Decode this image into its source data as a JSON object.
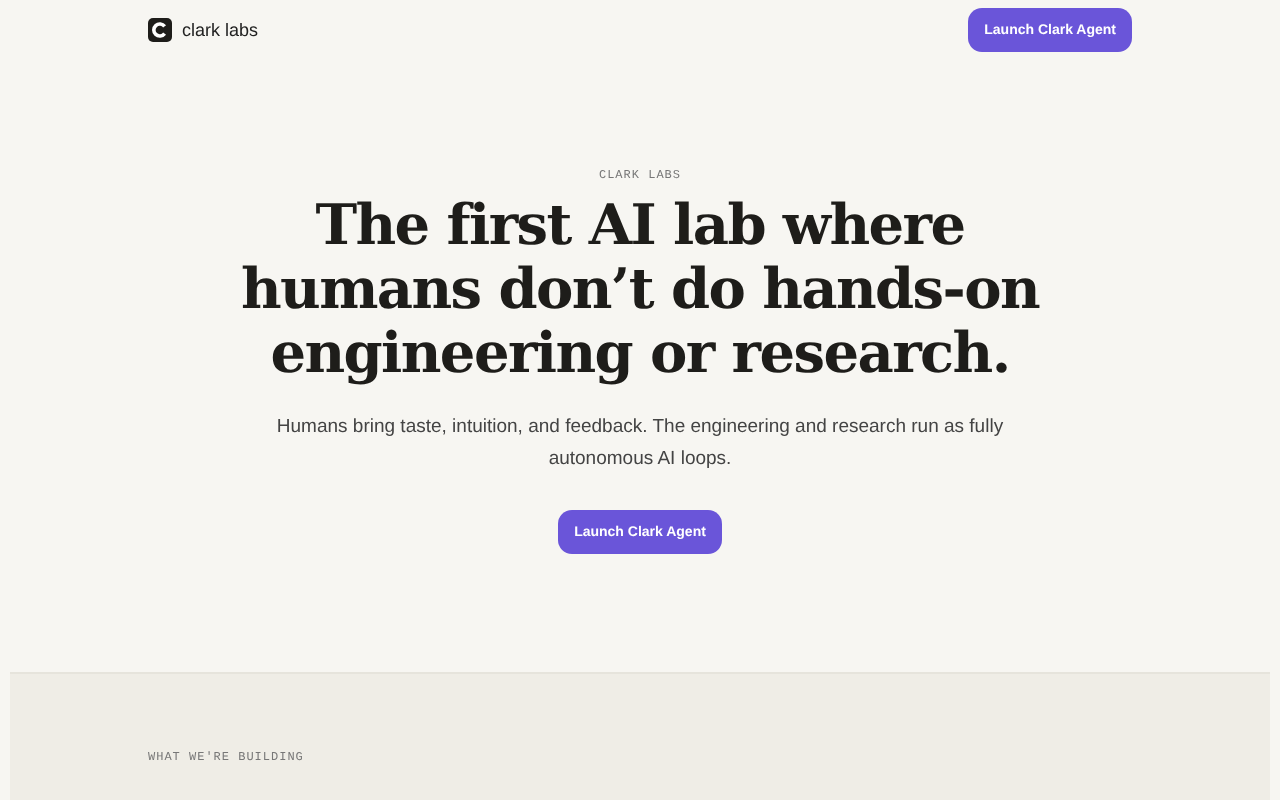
{
  "header": {
    "logo_text": "clark labs",
    "button": "Launch Clark Agent"
  },
  "hero": {
    "eyebrow": "CLARK LABS",
    "headline": [
      "The first AI lab where",
      "humans don’t do hands-on",
      "engineering or research."
    ],
    "subtitle": "Humans bring taste, intuition, and feedback. The engineering and research run as fully autonomous AI loops.",
    "button": "Launch Clark Agent"
  },
  "section": {
    "eyebrow": "WHAT WE'RE BUILDING"
  }
}
